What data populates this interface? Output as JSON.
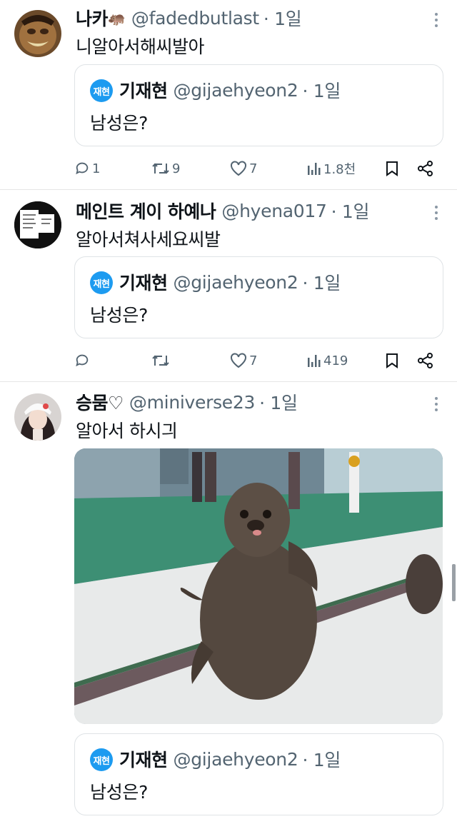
{
  "tweets": [
    {
      "name": "나카",
      "emoji": "🦛",
      "handle": "@fadedbutlast",
      "time": "· 1일",
      "text": "니알아서해씨발아",
      "quote": {
        "badge": "재현",
        "name": "기재현",
        "handle": "@gijaehyeon2",
        "time": "· 1일",
        "text": "남성은?"
      },
      "stats": {
        "replies": "1",
        "retweets": "9",
        "likes": "7",
        "views": "1.8천"
      }
    },
    {
      "name": "메인트 계이 하예나",
      "handle": "@hyena017",
      "time": "· 1일",
      "text": "알아서쳐사세요씨발",
      "quote": {
        "badge": "재현",
        "name": "기재현",
        "handle": "@gijaehyeon2",
        "time": "· 1일",
        "text": "남성은?"
      },
      "stats": {
        "replies": "",
        "retweets": "",
        "likes": "7",
        "views": "419"
      }
    },
    {
      "name": "승뭄♡",
      "handle": "@miniverse23",
      "time": "· 1일",
      "text": "알아서 하시긔",
      "quote": {
        "badge": "재현",
        "name": "기재현",
        "handle": "@gijaehyeon2",
        "time": "· 1일",
        "text": "남성은?"
      }
    }
  ],
  "icons": {
    "reply": "reply-icon",
    "retweet": "retweet-icon",
    "like": "heart-icon",
    "views": "views-icon",
    "bookmark": "bookmark-icon",
    "share": "share-icon",
    "more": "more-icon"
  },
  "colors": {
    "accent": "#1d9bf0",
    "secondary_text": "#536471",
    "border": "#dfe3e6"
  }
}
